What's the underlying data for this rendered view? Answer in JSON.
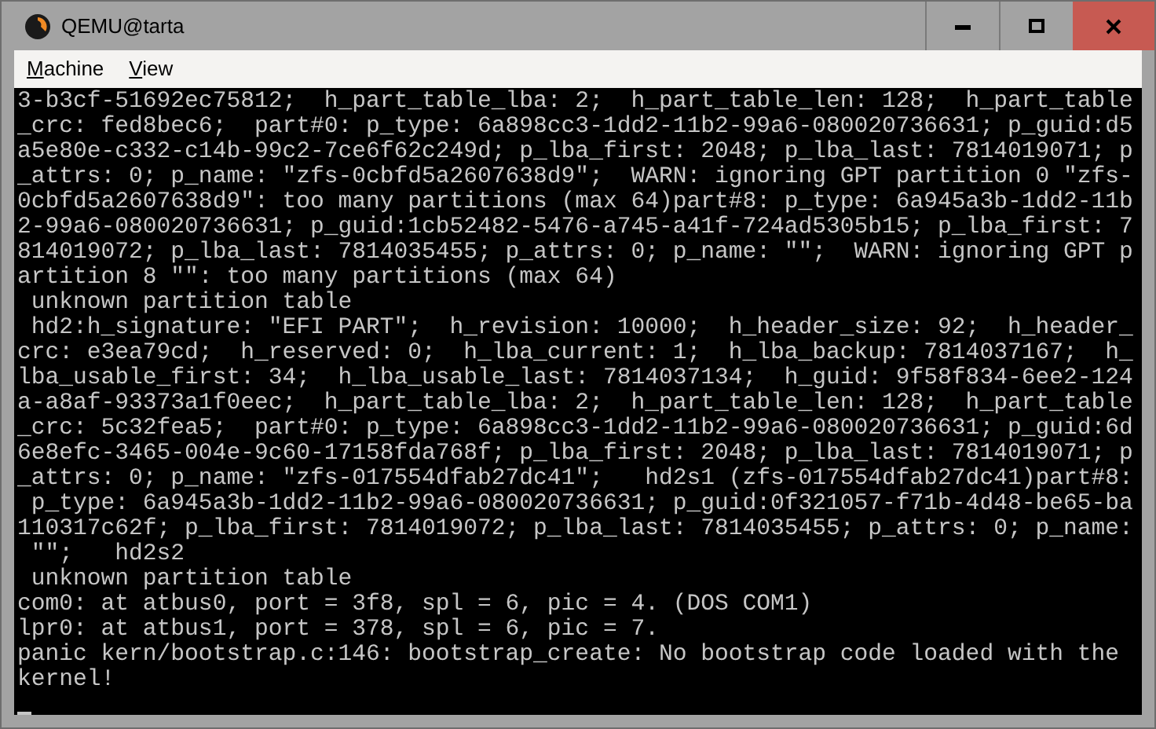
{
  "window": {
    "title": "QEMU@tarta"
  },
  "menu": [
    "Machine",
    "View"
  ],
  "console": {
    "lines": [
      "3-b3cf-51692ec75812;  h_part_table_lba: 2;  h_part_table_len: 128;  h_part_table",
      "_crc: fed8bec6;  part#0: p_type: 6a898cc3-1dd2-11b2-99a6-080020736631; p_guid:d5",
      "a5e80e-c332-c14b-99c2-7ce6f62c249d; p_lba_first: 2048; p_lba_last: 7814019071; p",
      "_attrs: 0; p_name: \"zfs-0cbfd5a2607638d9\";  WARN: ignoring GPT partition 0 \"zfs-",
      "0cbfd5a2607638d9\": too many partitions (max 64)part#8: p_type: 6a945a3b-1dd2-11b",
      "2-99a6-080020736631; p_guid:1cb52482-5476-a745-a41f-724ad5305b15; p_lba_first: 7",
      "814019072; p_lba_last: 7814035455; p_attrs: 0; p_name: \"\";  WARN: ignoring GPT p",
      "artition 8 \"\": too many partitions (max 64)",
      " unknown partition table",
      " hd2:h_signature: \"EFI PART\";  h_revision: 10000;  h_header_size: 92;  h_header_",
      "crc: e3ea79cd;  h_reserved: 0;  h_lba_current: 1;  h_lba_backup: 7814037167;  h_",
      "lba_usable_first: 34;  h_lba_usable_last: 7814037134;  h_guid: 9f58f834-6ee2-124",
      "a-a8af-93373a1f0eec;  h_part_table_lba: 2;  h_part_table_len: 128;  h_part_table",
      "_crc: 5c32fea5;  part#0: p_type: 6a898cc3-1dd2-11b2-99a6-080020736631; p_guid:6d",
      "6e8efc-3465-004e-9c60-17158fda768f; p_lba_first: 2048; p_lba_last: 7814019071; p",
      "_attrs: 0; p_name: \"zfs-017554dfab27dc41\";   hd2s1 (zfs-017554dfab27dc41)part#8:",
      " p_type: 6a945a3b-1dd2-11b2-99a6-080020736631; p_guid:0f321057-f71b-4d48-be65-ba",
      "110317c62f; p_lba_first: 7814019072; p_lba_last: 7814035455; p_attrs: 0; p_name:",
      " \"\";   hd2s2",
      " unknown partition table",
      "com0: at atbus0, port = 3f8, spl = 6, pic = 4. (DOS COM1)",
      "lpr0: at atbus1, port = 378, spl = 6, pic = 7.",
      "panic kern/bootstrap.c:146: bootstrap_create: No bootstrap code loaded with the",
      "kernel!"
    ]
  }
}
